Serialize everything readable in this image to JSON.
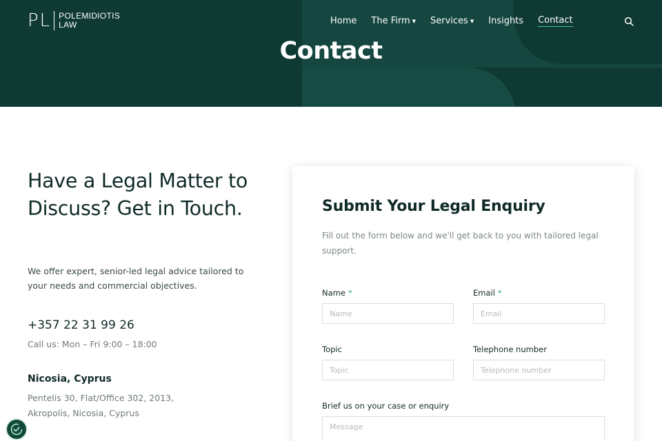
{
  "header": {
    "logo_mark": "PL",
    "logo_line1": "POLEMIDIOTIS",
    "logo_line2": "LAW",
    "nav": [
      {
        "label": "Home",
        "has_caret": false,
        "active": false
      },
      {
        "label": "The Firm",
        "has_caret": true,
        "active": false
      },
      {
        "label": "Services",
        "has_caret": true,
        "active": false
      },
      {
        "label": "Insights",
        "has_caret": false,
        "active": false
      },
      {
        "label": "Contact",
        "has_caret": false,
        "active": true
      }
    ],
    "search_icon": "search-icon",
    "page_title": "Contact"
  },
  "contact_info": {
    "heading": "Have a Legal Matter to Discuss? Get in Touch.",
    "intro": "We offer expert, senior-led legal advice tailored to your needs and commercial objectives.",
    "phone": "+357 22 31 99 26",
    "hours": "Call us: Mon – Fri 9:00 – 18:00",
    "office_title": "Nicosia, Cyprus",
    "office_address": "Pentelis 30, Flat/Office 302, 2013, Akropolis, Nicosia, Cyprus"
  },
  "form": {
    "title": "Submit Your Legal Enquiry",
    "subtitle": "Fill out the form below and we'll get back to you with tailored legal support.",
    "required_mark": "*",
    "name_label": "Name",
    "name_placeholder": "Name",
    "email_label": "Email",
    "email_placeholder": "Email",
    "topic_label": "Topic",
    "topic_placeholder": "Topic",
    "phone_label": "Telephone number",
    "phone_placeholder": "Telephone number",
    "message_label": "Brief us on your case or enquiry",
    "message_placeholder": "Message"
  },
  "colors": {
    "hero_bg": "#0f3a34",
    "accent": "#2fae7f",
    "text_dark": "#0f2a27"
  },
  "badge_icon": "cookie-settings-icon"
}
